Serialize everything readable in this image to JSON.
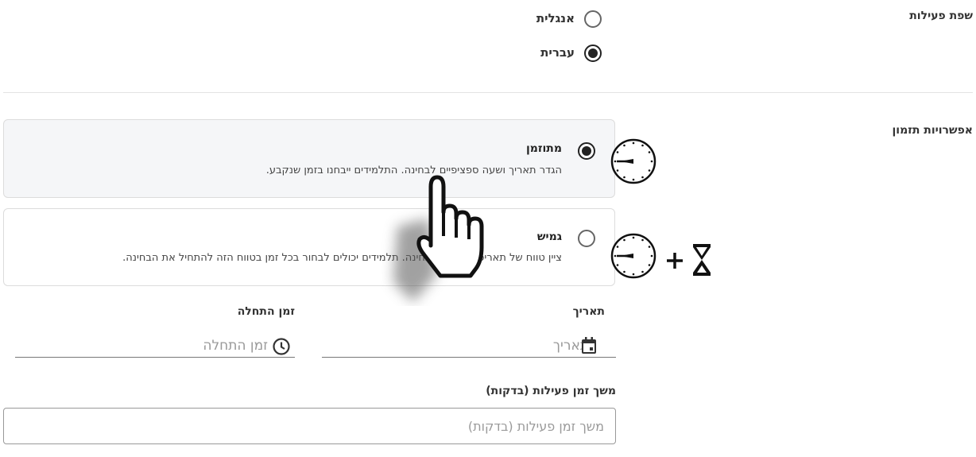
{
  "language": {
    "label": "שפת פעילות",
    "options": [
      {
        "label": "אנגלית",
        "selected": false
      },
      {
        "label": "עברית",
        "selected": true
      }
    ]
  },
  "timing": {
    "label": "אפשרויות תזמון",
    "options": [
      {
        "title": "מתוזמן",
        "description": "הגדר תאריך ושעה ספציפיים לבחינה. התלמידים ייבחנו בזמן שנקבע.",
        "selected": true,
        "icon": "clock-icon"
      },
      {
        "title": "גמיש",
        "description": "ציין טווח של תאריכים ושעות לבחינה. תלמידים יכולים לבחור בכל זמן בטווח הזה להתחיל את הבחינה.",
        "selected": false,
        "icon": "clock-plus-hourglass-icon"
      }
    ]
  },
  "date_field": {
    "label": "תאריך",
    "placeholder": "תאריך",
    "icon": "calendar-icon"
  },
  "start_time_field": {
    "label": "זמן התחלה",
    "placeholder": "זמן התחלה",
    "icon": "clock-icon"
  },
  "duration_field": {
    "label": "משך זמן פעילות (בדקות)",
    "placeholder": "משך זמן פעילות (בדקות)"
  },
  "cursor": {
    "icon": "hand-pointer-icon"
  }
}
